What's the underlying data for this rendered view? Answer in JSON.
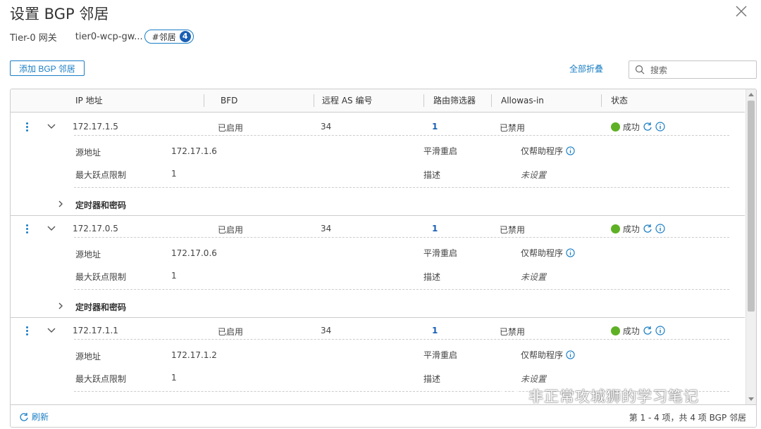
{
  "dialog": {
    "title": "设置 BGP 邻居",
    "crumbs": {
      "gateway_label": "Tier-0 网关",
      "gateway_name": "tier0-wcp-gw...",
      "pill_label": "#邻居",
      "pill_count": "4"
    }
  },
  "toolbar": {
    "add_label": "添加 BGP 邻居",
    "collapse_all": "全部折叠",
    "search_placeholder": "搜索"
  },
  "columns": [
    "IP 地址",
    "BFD",
    "远程 AS 编号",
    "路由筛选器",
    "Allowas-in",
    "状态"
  ],
  "labels": {
    "source": "源地址",
    "max_hop": "最大跃点限制",
    "graceful": "平滑重启",
    "desc": "描述",
    "timers": "定时器和密码"
  },
  "rows": [
    {
      "ip": "172.17.1.5",
      "bfd": "已启用",
      "remote_as": "34",
      "filters": "1",
      "allowas": "已禁用",
      "status": "成功",
      "source": "172.17.1.6",
      "max_hop": "1",
      "graceful": "仅帮助程序",
      "desc": "未设置"
    },
    {
      "ip": "172.17.0.5",
      "bfd": "已启用",
      "remote_as": "34",
      "filters": "1",
      "allowas": "已禁用",
      "status": "成功",
      "source": "172.17.0.6",
      "max_hop": "1",
      "graceful": "仅帮助程序",
      "desc": "未设置"
    },
    {
      "ip": "172.17.1.1",
      "bfd": "已启用",
      "remote_as": "34",
      "filters": "1",
      "allowas": "已禁用",
      "status": "成功",
      "source": "172.17.1.2",
      "max_hop": "1",
      "graceful": "仅帮助程序",
      "desc": "未设置"
    }
  ],
  "footer": {
    "refresh": "刷新",
    "pager": "第 1 - 4 项，共 4 项 BGP 邻居"
  },
  "watermark": "非正常攻城狮的学习笔记",
  "colors": {
    "accent": "#1a7ec4",
    "success": "#5eb124"
  }
}
